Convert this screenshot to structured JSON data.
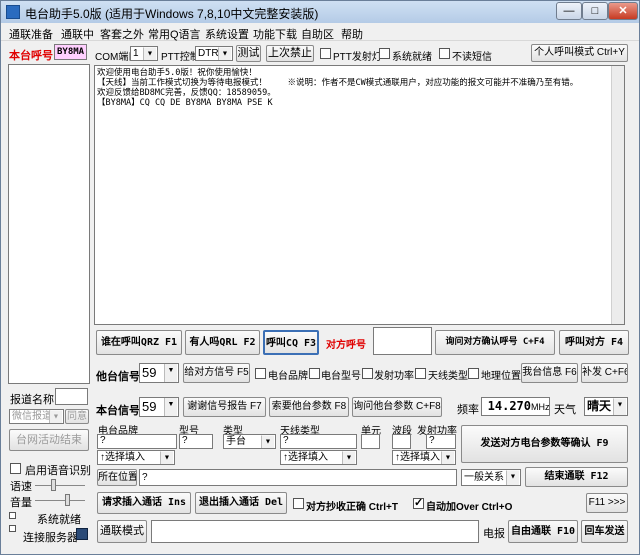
{
  "window": {
    "title": "电台助手5.0版 (适用于Windows 7,8,10中文完整安装版)",
    "min": "—",
    "max": "□",
    "close": "✕"
  },
  "menu": [
    "通联准备",
    "通联中",
    "客套之外",
    "常用Q语言",
    "系统设置",
    "功能下载",
    "自助区",
    "帮助"
  ],
  "left": {
    "my_call_label": "本台呼号",
    "my_call": "BY8MA",
    "list_label": "报道名称",
    "report_sel": "微信报道",
    "same_btn": "同意",
    "network_btn": "台网活动结束",
    "voice_chk": "启用语音识别",
    "speed_label": "语速",
    "volume_label": "音量",
    "sys_label": "系统就绪",
    "server_label": "连接服务器"
  },
  "toolbar": {
    "com_label": "COM端口",
    "com_value": "1",
    "ptt_label": "PTT控制",
    "ptt_value": "DTR",
    "test_btn": "测试",
    "last_ban": "上次禁止",
    "ptt_light": "PTT发射灯",
    "sys_ready": "系统就绪",
    "unread": "不读短信",
    "personal_btn": "个人呼叫模式 Ctrl+Y"
  },
  "log": "欢迎使用电台助手5.0版！祝你使用愉快！\n【天线】当前工作模式切换为等待电报模式！    ※说明：作者不是CW模式通联用户，对应功能的报文可能并不准确乃至有错。\n欢迎反馈给BD8MC完善，反馈QQ：18589059。\n【BY8MA】CQ CQ DE BY8MA BY8MA PSE K",
  "row1": {
    "qrz": "谁在呼叫QRZ F1",
    "qrl": "有人吗QRL F2",
    "cq": "呼叫CQ F3",
    "their_call_label": "对方呼号",
    "their_call": "",
    "confirm_btn": "询问对方确认呼号 C+F4",
    "call_their": "呼叫对方 F4"
  },
  "row2": {
    "signal_label": "他台信号",
    "signal": "59",
    "give_signal": "给对方信号 F5",
    "brand": "电台品牌",
    "model": "电台型号",
    "power": "发射功率",
    "antenna": "天线类型",
    "location": "地理位置",
    "my_info": "我台信息 F6",
    "repeat": "补发 C+F6"
  },
  "row3": {
    "signal_label": "本台信号",
    "signal": "59",
    "thanks": "谢谢信号报告 F7",
    "request": "索要他台参数 F8",
    "ask": "询问他台参数 C+F8",
    "freq_label": "频率",
    "freq": "14.270",
    "freq_unit": "MHz",
    "weather_label": "天气",
    "weather": "晴天"
  },
  "params": {
    "brand_label": "电台品牌",
    "model_label": "型号",
    "type_label": "类型",
    "antenna_label": "天线类型",
    "unit_label": "单元",
    "band_label": "波段",
    "power_label": "发射功率",
    "q": "?",
    "type_value": "手台",
    "select_fill": "↑选择填入",
    "send_btn": "发送对方电台参数等确认 F9"
  },
  "location": {
    "label": "所在位置",
    "value": "?",
    "relation": "一般关系",
    "end_btn": "结束通联 F12"
  },
  "row_insert": {
    "req": "请求插入通话 Ins",
    "exit": "退出插入通话 Del",
    "copy_chk": "对方抄收正确 Ctrl+T",
    "over_chk": "自动加Over Ctrl+O",
    "f11": "F11 >>>"
  },
  "bottom": {
    "mode_btn": "通联模式",
    "tele": "电报",
    "free_btn": "自由通联 F10",
    "enter_btn": "回车发送"
  }
}
